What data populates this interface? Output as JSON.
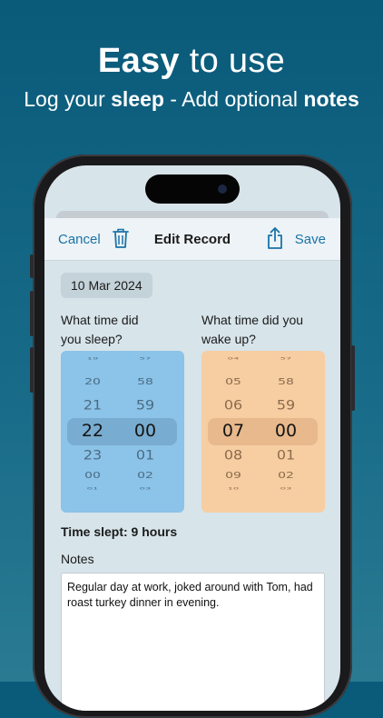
{
  "headline": {
    "bold": "Easy",
    "rest": " to use"
  },
  "subline": {
    "p1": "Log your ",
    "b1": "sleep",
    "p2": " - Add optional ",
    "b2": "notes"
  },
  "navbar": {
    "cancel": "Cancel",
    "title": "Edit Record",
    "save": "Save",
    "trash_icon": "trash-icon",
    "share_icon": "share-icon"
  },
  "date": "10 Mar 2024",
  "sleep_question": {
    "line1": "What time did",
    "line2": "you sleep?"
  },
  "wake_question": {
    "line1": "What time did you",
    "line2": "wake up?"
  },
  "sleep_picker": {
    "hours": [
      "19",
      "20",
      "21",
      "22",
      "23",
      "00",
      "01"
    ],
    "minutes": [
      "57",
      "58",
      "59",
      "00",
      "01",
      "02",
      "03"
    ],
    "selected_hour": "22",
    "selected_minute": "00",
    "color": "#8cc3e8"
  },
  "wake_picker": {
    "hours": [
      "04",
      "05",
      "06",
      "07",
      "08",
      "09",
      "10"
    ],
    "minutes": [
      "57",
      "58",
      "59",
      "00",
      "01",
      "02",
      "03"
    ],
    "selected_hour": "07",
    "selected_minute": "00",
    "color": "#f7cda2"
  },
  "time_slept": "Time slept: 9 hours",
  "notes_label": "Notes",
  "notes_text": "Regular day at work, joked around with Tom, had roast turkey dinner in evening."
}
